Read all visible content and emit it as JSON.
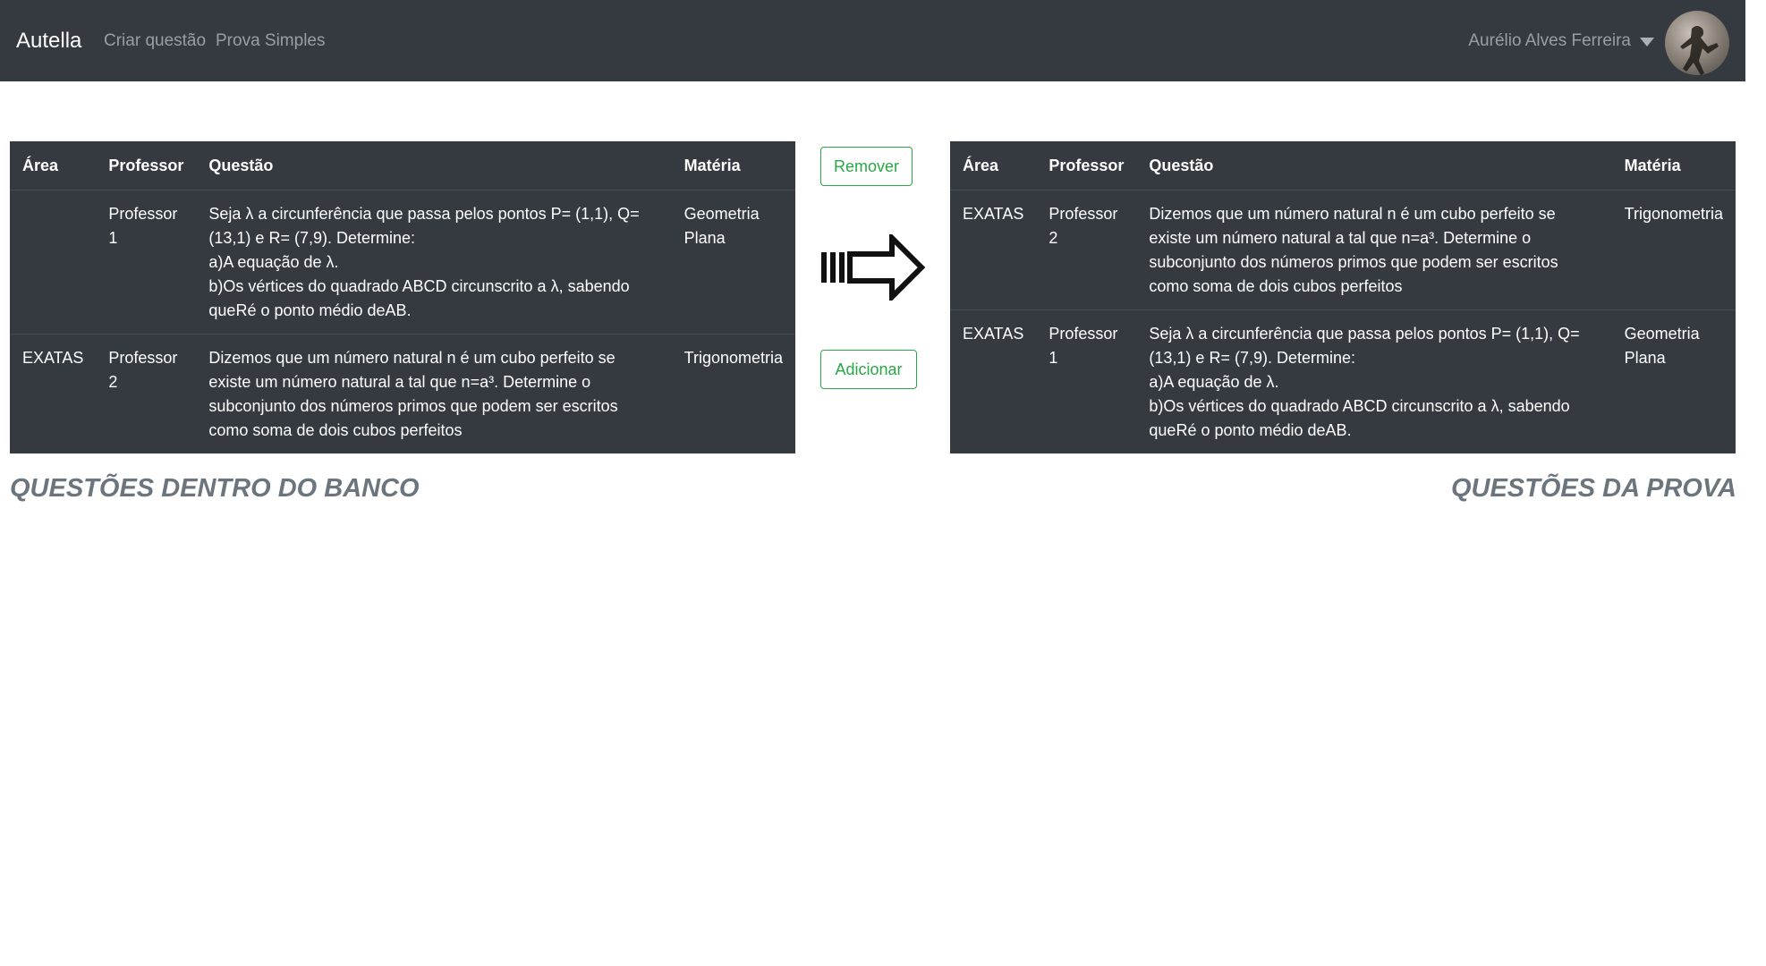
{
  "navbar": {
    "brand": "Autella",
    "links": [
      "Criar questão",
      "Prova Simples"
    ],
    "user_name": "Aurélio Alves Ferreira"
  },
  "colors": {
    "navbar_bg": "#343a40",
    "table_bg": "#343a40",
    "button_accent": "#28a745",
    "caption": "#6c757d"
  },
  "columns": [
    "Área",
    "Professor",
    "Questão",
    "Matéria"
  ],
  "bank_table": {
    "rows": [
      {
        "area": "",
        "professor": "Professor 1",
        "questao": [
          "Seja λ a circunferência que passa pelos pontos P= (1,1), Q= (13,1) e R= (7,9). Determine:",
          "a)A equação de λ.",
          "b)Os vértices do quadrado ABCD circunscrito a λ, sabendo queRé o ponto médio deAB."
        ],
        "materia": "Geometria Plana"
      },
      {
        "area": "EXATAS",
        "professor": "Professor 2",
        "questao": [
          "Dizemos que um número natural n é um cubo perfeito se existe um número natural a tal que n=a³. Determine o subconjunto dos números primos que podem ser escritos como soma de dois cubos perfeitos"
        ],
        "materia": "Trigonometria"
      }
    ]
  },
  "exam_table": {
    "rows": [
      {
        "area": "EXATAS",
        "professor": "Professor 2",
        "questao": [
          "Dizemos que um número natural n é um cubo perfeito se existe um número natural a tal que n=a³. Determine o subconjunto dos números primos que podem ser escritos como soma de dois cubos perfeitos"
        ],
        "materia": "Trigonometria"
      },
      {
        "area": "EXATAS",
        "professor": "Professor 1",
        "questao": [
          "Seja λ a circunferência que passa pelos pontos P= (1,1), Q= (13,1) e R= (7,9). Determine:",
          "a)A equação de λ.",
          "b)Os vértices do quadrado ABCD circunscrito a λ, sabendo queRé o ponto médio deAB."
        ],
        "materia": "Geometria Plana"
      }
    ]
  },
  "buttons": {
    "remove_label": "Remover",
    "add_label": "Adicionar"
  },
  "arrow_icon": "arrow-right-icon",
  "captions": {
    "bank": "QUESTÕES DENTRO DO BANCO",
    "exam": "QUESTÕES DA PROVA"
  }
}
